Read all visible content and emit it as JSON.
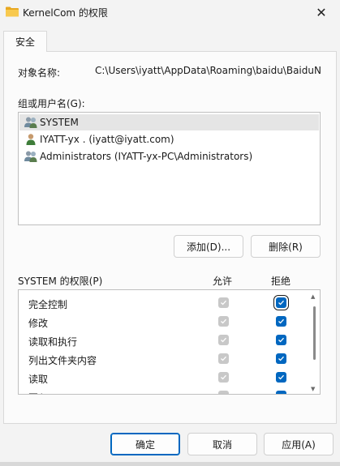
{
  "window": {
    "title": "KernelCom 的权限",
    "close_symbol": "✕",
    "title_icon": "folder-icon"
  },
  "tabs": [
    {
      "label": "安全"
    }
  ],
  "object": {
    "label": "对象名称:",
    "value": "C:\\Users\\iyatt\\AppData\\Roaming\\baidu\\BaiduNetdisk\\KernelCom"
  },
  "groups": {
    "label": "组或用户名(G):",
    "items": [
      {
        "name": "SYSTEM",
        "icon": "group-users-icon"
      },
      {
        "name": "IYATT-yx . (iyatt@iyatt.com)",
        "icon": "user-icon"
      },
      {
        "name": "Administrators (IYATT-yx-PC\\Administrators)",
        "icon": "group-users-icon"
      }
    ],
    "selected_index": 0
  },
  "buttons": {
    "add": "添加(D)...",
    "remove": "删除(R)",
    "ok": "确定",
    "cancel": "取消",
    "apply": "应用(A)"
  },
  "permissions": {
    "title": "SYSTEM 的权限(P)",
    "allow_header": "允许",
    "deny_header": "拒绝",
    "rows": [
      {
        "name": "完全控制",
        "allow": true,
        "deny": true
      },
      {
        "name": "修改",
        "allow": true,
        "deny": true
      },
      {
        "name": "读取和执行",
        "allow": true,
        "deny": true
      },
      {
        "name": "列出文件夹内容",
        "allow": true,
        "deny": true
      },
      {
        "name": "读取",
        "allow": true,
        "deny": true
      },
      {
        "name": "写入",
        "allow": true,
        "deny": true
      }
    ]
  },
  "colors": {
    "accent": "#0067c0",
    "disabled_check": "#c8c8c8",
    "folder": "#f5c04a"
  }
}
